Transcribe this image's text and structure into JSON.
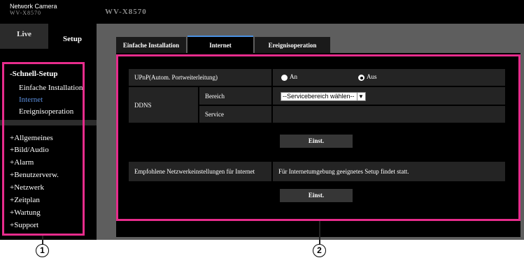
{
  "header": {
    "brand": "Network Camera",
    "model_sub": "WV-X8570",
    "model_title": "WV-X8570"
  },
  "top_tabs": {
    "live": "Live",
    "setup": "Setup"
  },
  "sidebar": {
    "schnell_setup": "-Schnell-Setup",
    "sub_items": [
      "Einfache Installation",
      "Internet",
      "Ereignisoperation"
    ],
    "menu": [
      "+Allgemeines",
      "+Bild/Audio",
      "+Alarm",
      "+Benutzerverw.",
      "+Netzwerk",
      "+Zeitplan",
      "+Wartung",
      "+Support"
    ]
  },
  "main_tabs": [
    "Einfache Installation",
    "Internet",
    "Ereignisoperation"
  ],
  "form": {
    "upnp_label": "UPnP(Autom. Portweiterleitung)",
    "upnp_on": "An",
    "upnp_off": "Aus",
    "upnp_selected": "Aus",
    "ddns_label": "DDNS",
    "bereich_label": "Bereich",
    "bereich_value": "--Servicebereich wählen--",
    "service_label": "Service",
    "set_button_1": "Einst.",
    "recommended_label": "Empfohlene Netzwerkeinstellungen für Internet",
    "recommended_desc": "Für Internetumgebung geeignetes Setup findet statt.",
    "set_button_2": "Einst."
  },
  "annotations": {
    "callout_1": "1",
    "callout_2": "2"
  },
  "colors": {
    "highlight": "#e72c8c",
    "active_link": "#5b8edc",
    "tab_accent": "#4a90e2"
  }
}
